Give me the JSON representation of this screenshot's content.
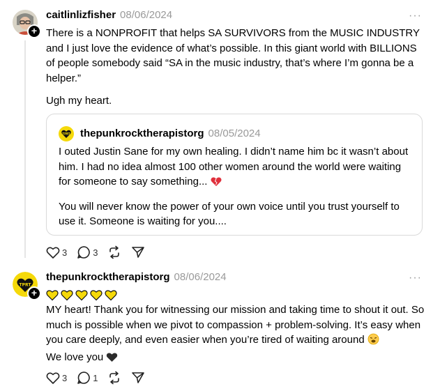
{
  "posts": [
    {
      "username": "caitlinlizfisher",
      "date": "08/06/2024",
      "more_label": "···",
      "paragraphs": [
        "There is a NONPROFIT that helps SA SURVIVORS from the MUSIC INDUSTRY and I just love the evidence of what’s possible. In this giant world with BILLIONS of people somebody said “SA in the music industry, that’s where I’m gonna be a helper.”",
        "Ugh my heart."
      ],
      "quote": {
        "username": "thepunkrocktherapistorg",
        "date": "08/05/2024",
        "avatar_text": "TPRT",
        "paragraph1": "I outed Justin Sane for my own healing. I didn’t name him bc it wasn’t about him. I had no idea almost 100 other women around the world were waiting for someone to say something...",
        "paragraph2": "You will never know the power of your own voice until you trust yourself to use it. Someone is waiting for you...."
      },
      "actions": {
        "like_count": "3",
        "reply_count": "3"
      }
    },
    {
      "username": "thepunkrocktherapistorg",
      "date": "08/06/2024",
      "more_label": "···",
      "avatar_text": "TPRT",
      "line1": "MY heart! Thank you for witnessing our mission and taking time to shout it out. So much is possible when we pivot to compassion + problem-solving. It’s easy when you care deeply, and even easier when you’re tired of waiting around",
      "line2": "We love you",
      "actions": {
        "like_count": "3",
        "reply_count": "1"
      }
    }
  ],
  "colors": {
    "accent_yellow": "#f5d90a",
    "heart_red": "#e0303c",
    "muted": "#999999",
    "border": "#d9d9d9"
  }
}
